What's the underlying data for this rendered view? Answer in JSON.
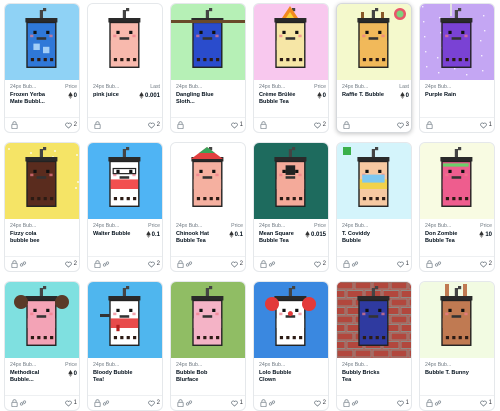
{
  "cards": [
    {
      "collection": "24px Bub...",
      "name": "Frozen Yerba Mate Bubbl...",
      "price_label": "Price",
      "price": "0",
      "likes": "2",
      "bg": "#8fd2f5",
      "cup": "#2f78d8",
      "tea": "#2f78d8",
      "face": "#2f78d8",
      "extra": "ice"
    },
    {
      "collection": "24px Bub...",
      "name": "pink juice",
      "price_label": "Last",
      "price": "0.001",
      "likes": "2",
      "bg": "#ffffff",
      "cup": "#f8b9ad",
      "tea": "#f8b9ad",
      "face": "#f8b9ad",
      "extra": "none"
    },
    {
      "collection": "24px Bub...",
      "name": "Dangling Blue Sloth...",
      "price_label": "",
      "price": "",
      "likes": "1",
      "bg": "#b6f0b6",
      "cup": "#2a4ccc",
      "tea": "#2a4ccc",
      "face": "#2a4ccc",
      "extra": "sloth"
    },
    {
      "collection": "24px Bub...",
      "name": "Crème Brûlée Bubble Tea",
      "price_label": "Price",
      "price": "0",
      "likes": "2",
      "bg": "#f8c8ee",
      "cup": "#f6e6a6",
      "tea": "#f6e6a6",
      "face": "#f6e6a6",
      "extra": "fire"
    },
    {
      "collection": "24px Bub...",
      "name": "Raffie T. Bubble",
      "price_label": "Last",
      "price": "0",
      "likes": "3",
      "bg": "#f4f9cc",
      "cup": "#f1b95a",
      "tea": "#f1b95a",
      "face": "#f1b95a",
      "extra": "giraffe"
    },
    {
      "collection": "24px Bub...",
      "name": "Purple Rain",
      "price_label": "",
      "price": "",
      "likes": "1",
      "bg": "#c4a6f3",
      "cup": "#7a42d4",
      "tea": "#7a42d4",
      "face": "#7a42d4",
      "extra": "rain"
    },
    {
      "collection": "24px Bub...",
      "name": "Fizzy cola bubble bee",
      "price_label": "",
      "price": "",
      "likes": "2",
      "bg": "#f5e466",
      "cup": "#5a2c1e",
      "tea": "#5a2c1e",
      "face": "#5a2c1e",
      "extra": "fizz"
    },
    {
      "collection": "24px Bub...",
      "name": "Walter Bubble",
      "price_label": "Price",
      "price": "0.1",
      "likes": "2",
      "bg": "#4fb4f4",
      "cup": "#ffffff",
      "tea": "#f24f4f",
      "face": "#f8c6a6",
      "extra": "walter"
    },
    {
      "collection": "24px Bub...",
      "name": "Chinook Hat Bubble Tea",
      "price_label": "Price",
      "price": "0.1",
      "likes": "2",
      "bg": "#ffffff",
      "cup": "#f5b0a0",
      "tea": "#f5b0a0",
      "face": "#f5b0a0",
      "extra": "hat"
    },
    {
      "collection": "24px Bub...",
      "name": "Mean Square Bubble Tea",
      "price_label": "Price",
      "price": "0.015",
      "likes": "2",
      "bg": "#1e6b5e",
      "cup": "#f4aa9a",
      "tea": "#f4aa9a",
      "face": "#f4aa9a",
      "extra": "square"
    },
    {
      "collection": "24px Bub...",
      "name": "T. Coviddy Bubble",
      "price_label": "",
      "price": "",
      "likes": "1",
      "bg": "#d4f4fb",
      "cup": "#f6c9a2",
      "tea": "#f2d24a",
      "face": "#f6c9a2",
      "extra": "mask"
    },
    {
      "collection": "24px Bub...",
      "name": "Don Zombie Bubble Tea",
      "price_label": "Price",
      "price": "10",
      "likes": "2",
      "bg": "#f8fbe2",
      "cup": "#ee5d8e",
      "tea": "#ee5d8e",
      "face": "#ee5d8e",
      "extra": "zombie"
    },
    {
      "collection": "24px Bub...",
      "name": "Methodical Bubble...",
      "price_label": "Price",
      "price": "0",
      "likes": "1",
      "bg": "#7fe0e0",
      "cup": "#f3a3b6",
      "tea": "#f3a3b6",
      "face": "#f3a3b6",
      "extra": "mouse"
    },
    {
      "collection": "24px Bub...",
      "name": "Bloody Bubble Tea!",
      "price_label": "",
      "price": "",
      "likes": "2",
      "bg": "#4fb6ee",
      "cup": "#ffffff",
      "tea": "#e84b4b",
      "face": "#f4d6c2",
      "extra": "bloody"
    },
    {
      "collection": "24px Bub...",
      "name": "Bubble Bob Blurface",
      "price_label": "",
      "price": "",
      "likes": "1",
      "bg": "#90bd64",
      "cup": "#f4b3c6",
      "tea": "#f4b3c6",
      "face": "#f4b3c6",
      "extra": "none"
    },
    {
      "collection": "24px Bub...",
      "name": "Lolo Bubble Clown",
      "price_label": "",
      "price": "",
      "likes": "2",
      "bg": "#3a88e0",
      "cup": "#ffffff",
      "tea": "#ffffff",
      "face": "#ffffff",
      "extra": "clown"
    },
    {
      "collection": "24px Bub...",
      "name": "Bubbly Bricks Tea",
      "price_label": "",
      "price": "",
      "likes": "1",
      "bg": "#c24f45",
      "cup": "#2f3aa0",
      "tea": "#2f3aa0",
      "face": "#2f3aa0",
      "extra": "bricks"
    },
    {
      "collection": "24px Bub...",
      "name": "Bubble T. Bunny",
      "price_label": "",
      "price": "",
      "likes": "1",
      "bg": "#f2fbe2",
      "cup": "#c07a52",
      "tea": "#c07a52",
      "face": "#c07a52",
      "extra": "bunny"
    }
  ]
}
